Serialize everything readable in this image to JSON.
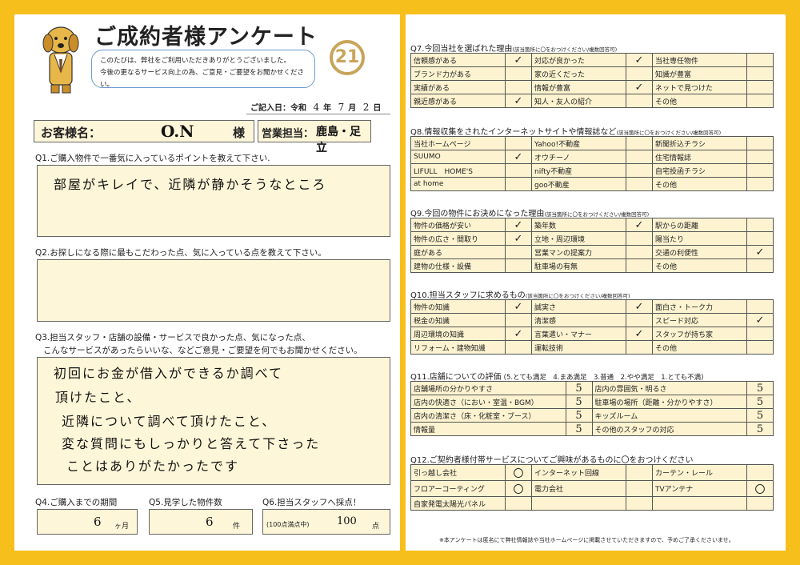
{
  "left": {
    "title": "ご成約者様アンケート",
    "logo": "21",
    "greeting": [
      "このたびは、弊社をご利用いただきありがとうございました。",
      "今後の更なるサービス向上の為、ご意見・ご要望をお聞かせください。"
    ],
    "date": {
      "label": "ご記入日：令和",
      "year": "4",
      "year_unit": "年",
      "month": "7",
      "month_unit": "月",
      "day": "2",
      "day_unit": "日"
    },
    "customer": {
      "label": "お客様名：",
      "value": "O.N",
      "suffix": "様"
    },
    "sales": {
      "label": "営業担当：",
      "value": "鹿島・足立"
    },
    "q1": {
      "text": "Q1.ご購入物件で一番気に入っているポイントを教えて下さい.",
      "answer": "部屋がキレイで、近隣が静かそうなところ"
    },
    "q2": {
      "text": "Q2.お探しになる際に最もこだわった点、気に入っている点を教えて下さい。",
      "answer": ""
    },
    "q3": {
      "text": [
        "Q3.担当スタッフ・店舗の設備・サービスで良かった点、気になった点、",
        "こんなサービスがあったらいいな、などご意見・ご要望を何でもお聞かせください。"
      ],
      "answer": [
        "初回にお金が借入ができるか調べて",
        "頂けたこと、",
        "近隣について調べて頂けたこと、",
        "変な質問にもしっかりと答えて下さった",
        "ことはありがたかったです"
      ]
    },
    "q4": {
      "text": "Q4.ご購入までの期間",
      "value": "6",
      "unit": "ヶ月"
    },
    "q5": {
      "text": "Q5.見学した物件数",
      "value": "6",
      "unit": "件"
    },
    "q6": {
      "text": "Q6.担当スタッフへ採点！",
      "note": "(100点満点中)",
      "value": "100",
      "unit": "点"
    }
  },
  "right": {
    "q7": {
      "title": "Q7.今回当社を選ばれた理由",
      "note": "(該当箇所に〇をおつけください/複数回答可)",
      "rows": [
        [
          "信頼感がある",
          "✓",
          "対応が良かった",
          "✓",
          "当社専任物件",
          ""
        ],
        [
          "ブランド力がある",
          "",
          "家の近くだった",
          "",
          "知識が豊富",
          ""
        ],
        [
          "実績がある",
          "",
          "情報が豊富",
          "✓",
          "ネットで見つけた",
          ""
        ],
        [
          "親近感がある",
          "✓",
          "知人・友人の紹介",
          "",
          "その他",
          ""
        ]
      ]
    },
    "q8": {
      "title": "Q8.情報収集をされたインターネットサイトや情報誌など",
      "note": "(該当箇所に〇をおつけください/複数回答可)",
      "rows": [
        [
          "当社ホームページ",
          "",
          "Yahoo!不動産",
          "",
          "新聞折込チラシ",
          ""
        ],
        [
          "SUUMO",
          "✓",
          "オウチーノ",
          "",
          "住宅情報誌",
          ""
        ],
        [
          "LIFULL　HOME'S",
          "",
          "nifty不動産",
          "",
          "自宅投函チラシ",
          ""
        ],
        [
          "at home",
          "",
          "goo不動産",
          "",
          "その他",
          ""
        ]
      ]
    },
    "q9": {
      "title": "Q9.今回の物件にお決めになった理由",
      "note": "(該当箇所に〇をおつけください/複数回答可)",
      "rows": [
        [
          "物件の価格が安い",
          "✓",
          "築年数",
          "✓",
          "駅からの距離",
          ""
        ],
        [
          "物件の広さ・間取り",
          "✓",
          "立地・周辺環境",
          "",
          "陽当たり",
          ""
        ],
        [
          "庭がある",
          "",
          "営業マンの提案力",
          "",
          "交通の利便性",
          "✓"
        ],
        [
          "建物の仕様・設備",
          "",
          "駐車場の有無",
          "",
          "その他",
          ""
        ]
      ]
    },
    "q10": {
      "title": "Q10.担当スタッフに求めるもの",
      "note": "(該当箇所に〇をおつけください/複数回答可)",
      "rows": [
        [
          "物件の知識",
          "✓",
          "誠実さ",
          "✓",
          "面白さ・トーク力",
          ""
        ],
        [
          "税金の知識",
          "",
          "清潔感",
          "",
          "スピード対応",
          "✓"
        ],
        [
          "周辺環境の知識",
          "✓",
          "言葉遣い・マナー",
          "✓",
          "スタッフが持ち家",
          ""
        ],
        [
          "リフォーム・建物知識",
          "",
          "運転技術",
          "",
          "その他",
          ""
        ]
      ]
    },
    "q11": {
      "title": "Q11.店舗についての評価",
      "scale": "(5.とても満足　4.まあ満足　3.普通　2.やや満足　1.とても不満)",
      "rows": [
        [
          "店舗場所の分かりやすさ",
          "5",
          "店内の雰囲気・明るさ",
          "5"
        ],
        [
          "店内の快適さ（におい・室温・BGM）",
          "5",
          "駐車場の場所（距離・分かりやすさ）",
          "5"
        ],
        [
          "店内の清潔さ（床・化粧室・ブース）",
          "5",
          "キッズルーム",
          "5"
        ],
        [
          "情報量",
          "5",
          "その他のスタッフの対応",
          "5"
        ]
      ]
    },
    "q12": {
      "title": "Q12.ご契約者様付帯サービスについてご興味があるものに〇をおつけください",
      "rows": [
        [
          "引っ越し会社",
          "〇",
          "インターネット回線",
          "",
          "カーテン・レール",
          ""
        ],
        [
          "フロアーコーティング",
          "〇",
          "電力会社",
          "",
          "TVアンテナ",
          "〇"
        ],
        [
          "自家発電太陽光パネル",
          "",
          "",
          "",
          "",
          ""
        ]
      ]
    },
    "footer": "※本アンケートは匿名にて弊社情報誌や当社ホームページに掲載させていただきますので、予めご了承くださいませ。"
  },
  "colors": {
    "frame": "#f6bf1c",
    "field": "#fef6d8",
    "logo": "#c8a45a",
    "bubble_border": "#6a9ad0"
  }
}
